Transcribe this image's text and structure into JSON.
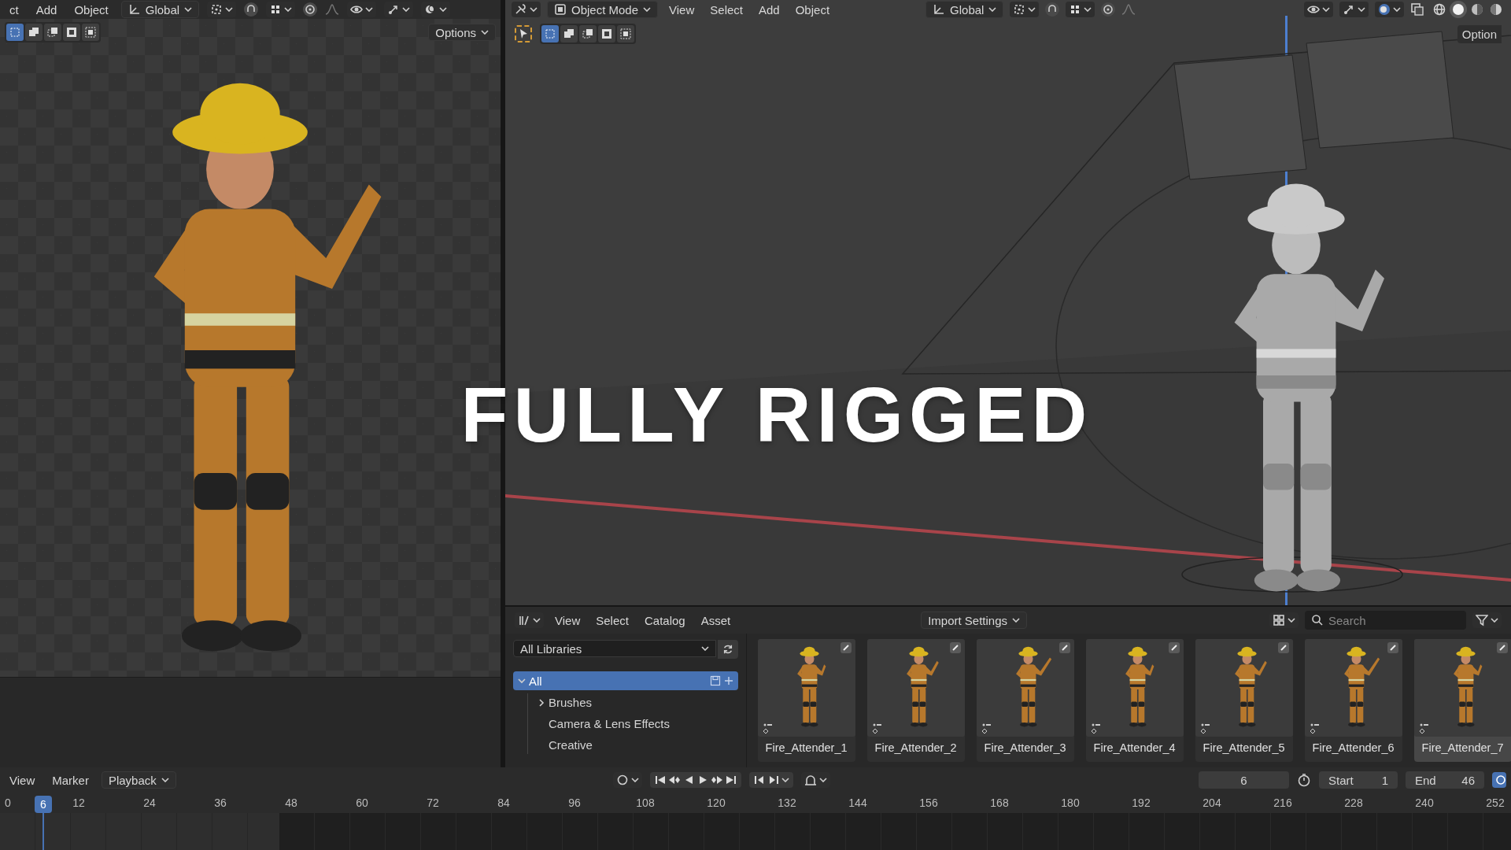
{
  "left_editor": {
    "header": {
      "menus": [
        "ct",
        "Add",
        "Object"
      ],
      "orientation": "Global"
    },
    "select_modes": [
      {
        "kind": "set",
        "selected": true
      },
      {
        "kind": "extend",
        "selected": false
      },
      {
        "kind": "subtract",
        "selected": false
      },
      {
        "kind": "invert",
        "selected": false
      },
      {
        "kind": "intersect",
        "selected": false
      }
    ],
    "options": "Options"
  },
  "viewport": {
    "header": {
      "mode": "Object Mode",
      "menus": [
        "View",
        "Select",
        "Add",
        "Object"
      ],
      "orientation": "Global",
      "options": "Option"
    },
    "select_modes": [
      {
        "kind": "set",
        "selected": true
      },
      {
        "kind": "extend",
        "selected": false
      },
      {
        "kind": "subtract",
        "selected": false
      },
      {
        "kind": "invert",
        "selected": false
      },
      {
        "kind": "intersect",
        "selected": false
      }
    ],
    "shading_modes": [
      {
        "kind": "wireframe",
        "selected": false
      },
      {
        "kind": "solid",
        "selected": true
      },
      {
        "kind": "material",
        "selected": false
      },
      {
        "kind": "rendered",
        "selected": false
      }
    ]
  },
  "overlay_title": "FULLY RIGGED",
  "asset_browser": {
    "menus": [
      "View",
      "Select",
      "Catalog",
      "Asset"
    ],
    "import_settings": "Import Settings",
    "search": {
      "placeholder": "Search"
    },
    "library": "All Libraries",
    "catalogs": [
      {
        "label": "All",
        "selected": true,
        "expanded": true,
        "children": [
          {
            "label": "Brushes",
            "selected": false,
            "expanded": false
          },
          {
            "label": "Camera & Lens Effects",
            "selected": false
          },
          {
            "label": "Creative",
            "selected": false
          }
        ]
      }
    ],
    "assets": [
      {
        "name": "Fire_Attender_1",
        "selected": false
      },
      {
        "name": "Fire_Attender_2",
        "selected": false
      },
      {
        "name": "Fire_Attender_3",
        "selected": false
      },
      {
        "name": "Fire_Attender_4",
        "selected": false
      },
      {
        "name": "Fire_Attender_5",
        "selected": false
      },
      {
        "name": "Fire_Attender_6",
        "selected": false
      },
      {
        "name": "Fire_Attender_7",
        "selected": true
      }
    ]
  },
  "timeline": {
    "menus": [
      "View",
      "Marker"
    ],
    "playback": "Playback",
    "current_frame": "6",
    "start_label": "Start",
    "start": "1",
    "end_label": "End",
    "end": "46",
    "playhead": "6",
    "ruler": [
      "0",
      "12",
      "24",
      "36",
      "48",
      "60",
      "72",
      "84",
      "96",
      "108",
      "120",
      "132",
      "144",
      "156",
      "168",
      "180",
      "192",
      "204",
      "216",
      "228",
      "240",
      "252"
    ]
  }
}
